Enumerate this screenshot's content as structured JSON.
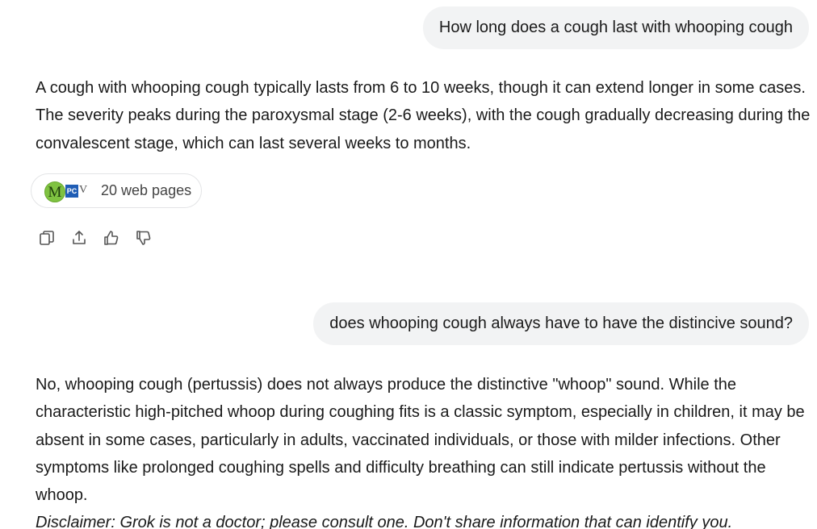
{
  "conversation": {
    "question1": "How long does a cough last with whooping cough",
    "answer1": "A cough with whooping cough typically lasts from 6 to 10 weeks, though it can extend longer in some cases. The severity peaks during the paroxysmal stage (2-6 weeks), with the cough gradually decreasing during the convalescent stage, which can last several weeks to months.",
    "sources": {
      "label": "20 web pages",
      "favicons": [
        {
          "icon": "m-favicon",
          "text": "M",
          "color": "#7fc241"
        },
        {
          "icon": "pc-favicon",
          "text": "PC",
          "color": "#1f5db5"
        },
        {
          "icon": "v-favicon",
          "text": "V",
          "color": "#555555"
        }
      ]
    },
    "actions": [
      {
        "name": "copy",
        "icon": "copy-icon"
      },
      {
        "name": "share",
        "icon": "share-icon"
      },
      {
        "name": "like",
        "icon": "thumbs-up-icon"
      },
      {
        "name": "dislike",
        "icon": "thumbs-down-icon"
      }
    ],
    "question2": "does whooping cough always have to have the distincive sound?",
    "answer2": "No, whooping cough (pertussis) does not always produce the distinctive \"whoop\" sound. While the characteristic high-pitched whoop during coughing fits is a classic symptom, especially in children, it may be absent in some cases, particularly in adults, vaccinated individuals, or those with milder infections. Other symptoms like prolonged coughing spells and difficulty breathing can still indicate pertussis without the whoop.",
    "disclaimer": "Disclaimer: Grok is not a doctor; please consult one. Don't share information that can identify you."
  }
}
